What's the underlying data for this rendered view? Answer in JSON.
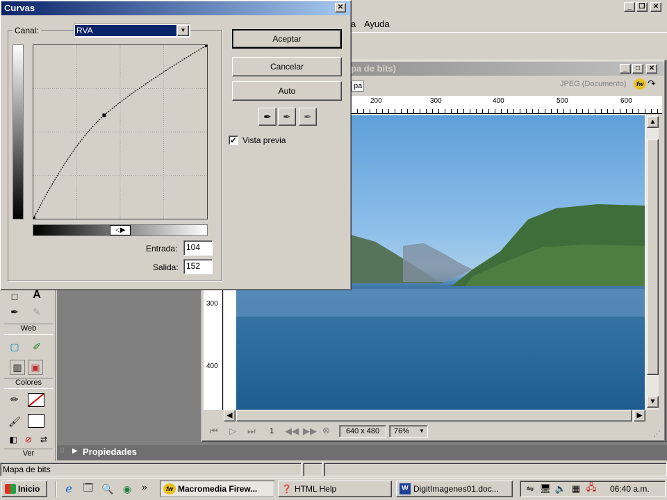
{
  "app": {
    "menu_visible": [
      "a",
      "Ayuda"
    ],
    "title_btns": [
      "_",
      "❐",
      "✕"
    ]
  },
  "doc": {
    "title_suffix": "pa de bits)",
    "tab_label": "pa",
    "format_label": "JPEG (Documento)",
    "ruler_top": [
      "200",
      "300",
      "400",
      "500",
      "600"
    ],
    "ruler_left": [
      "300",
      "400"
    ],
    "frame": "1",
    "size": "640 x 480",
    "zoom": "76%"
  },
  "tools": {
    "web_label": "Web",
    "colors_label": "Colores",
    "view_label": "Ver"
  },
  "props": {
    "label": "Propiedades"
  },
  "status": {
    "text": "Mapa de bits"
  },
  "dialog": {
    "title": "Curvas",
    "canal_label": "Canal:",
    "canal_value": "RVA",
    "accept": "Aceptar",
    "cancel": "Cancelar",
    "auto": "Auto",
    "preview_label": "Vista previa",
    "preview_checked": true,
    "entrada_label": "Entrada:",
    "entrada_value": "104",
    "salida_label": "Salida:",
    "salida_value": "152",
    "curve": {
      "input": 104,
      "output": 152,
      "max": 255
    }
  },
  "taskbar": {
    "start": "Inicio",
    "chev": "»",
    "items": [
      "Macromedia Firew...",
      "HTML Help",
      "DigitImagenes01.doc..."
    ],
    "clock": "06:40 a.m."
  },
  "colors": {
    "title_active": "#0a246a",
    "title_active2": "#a6caf0",
    "title_inactive": "#808080",
    "title_inactive2": "#c0c0c0",
    "canvas_bg": "#808080",
    "props_bg": "#6f6f6f"
  }
}
